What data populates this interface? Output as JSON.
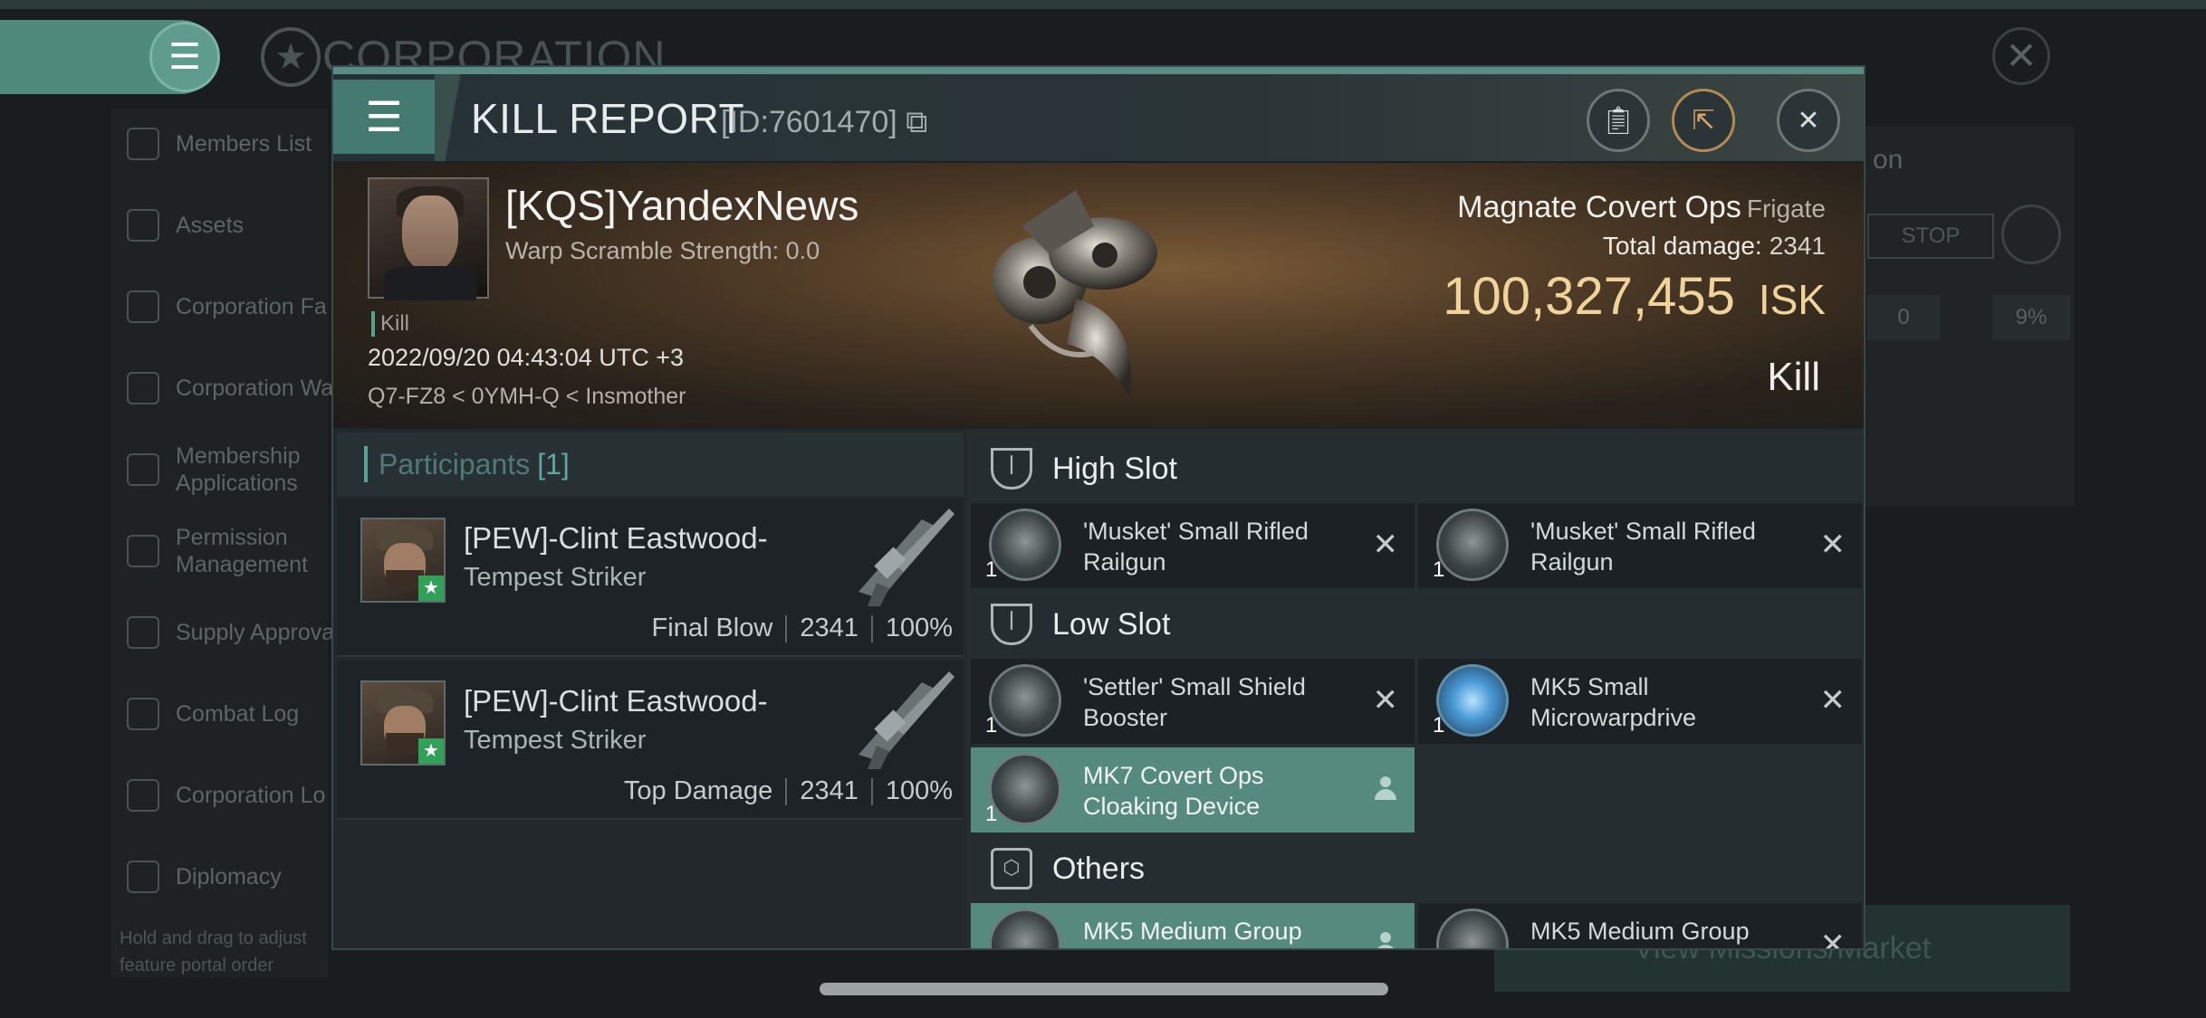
{
  "background": {
    "app_title": "CORPORATION",
    "sidebar_items": [
      {
        "label": "Members List",
        "icon": "members-icon"
      },
      {
        "label": "Assets",
        "icon": "assets-icon"
      },
      {
        "label": "Corporation Fa",
        "icon": "facilities-icon"
      },
      {
        "label": "Corporation Wa",
        "icon": "wallet-icon"
      },
      {
        "label": "Membership Applications",
        "icon": "applications-icon"
      },
      {
        "label": "Permission Management",
        "icon": "permission-icon"
      },
      {
        "label": "Supply Approva",
        "icon": "supply-icon"
      },
      {
        "label": "Combat Log",
        "icon": "combat-icon"
      },
      {
        "label": "Corporation Lo",
        "icon": "log-icon"
      },
      {
        "label": "Diplomacy",
        "icon": "diplomacy-icon"
      }
    ],
    "sidebar_hint": "Hold and drag to adjust feature portal order",
    "right_text": "on",
    "stop_label": "STOP",
    "stats": [
      "0",
      "9%"
    ],
    "market_button": "View Missions/Market"
  },
  "dialog": {
    "title": "KILL REPORT",
    "report_id": "[ID:7601470]",
    "victim": {
      "name": "[KQS]YandexNews",
      "warp_scramble": "Warp Scramble Strength: 0.0",
      "tag": "Kill",
      "datetime": "2022/09/20 04:43:04 UTC +3",
      "location": "Q7-FZ8 < 0YMH-Q < Insmother"
    },
    "ship": {
      "name": "Magnate Covert Ops",
      "class": "Frigate",
      "total_damage_label": "Total damage:",
      "total_damage": "2341",
      "value": "100,327,455",
      "value_unit": "ISK",
      "result": "Kill"
    },
    "participants": {
      "label": "Participants",
      "count": "[1]",
      "rows": [
        {
          "name": "[PEW]-Clint Eastwood-",
          "ship": "Tempest Striker",
          "role": "Final Blow",
          "damage": "2341",
          "percent": "100%"
        },
        {
          "name": "[PEW]-Clint Eastwood-",
          "ship": "Tempest Striker",
          "role": "Top Damage",
          "damage": "2341",
          "percent": "100%"
        }
      ]
    },
    "slots": {
      "high": {
        "label": "High Slot",
        "modules": [
          {
            "name": "'Musket' Small Rifled Railgun",
            "qty": "1",
            "action": "✕"
          },
          {
            "name": "'Musket' Small Rifled Railgun",
            "qty": "1",
            "action": "✕"
          }
        ]
      },
      "low": {
        "label": "Low Slot",
        "modules": [
          {
            "name": "'Settler' Small Shield Booster",
            "qty": "1",
            "action": "✕"
          },
          {
            "name": "MK5 Small Microwarpdrive",
            "qty": "1",
            "action": "✕"
          },
          {
            "name": "MK7 Covert Ops Cloaking Device",
            "qty": "1"
          }
        ]
      },
      "others": {
        "label": "Others",
        "modules": [
          {
            "name": "MK5 Medium Group"
          },
          {
            "name": "MK5 Medium Group",
            "action": "✕"
          }
        ]
      }
    }
  }
}
